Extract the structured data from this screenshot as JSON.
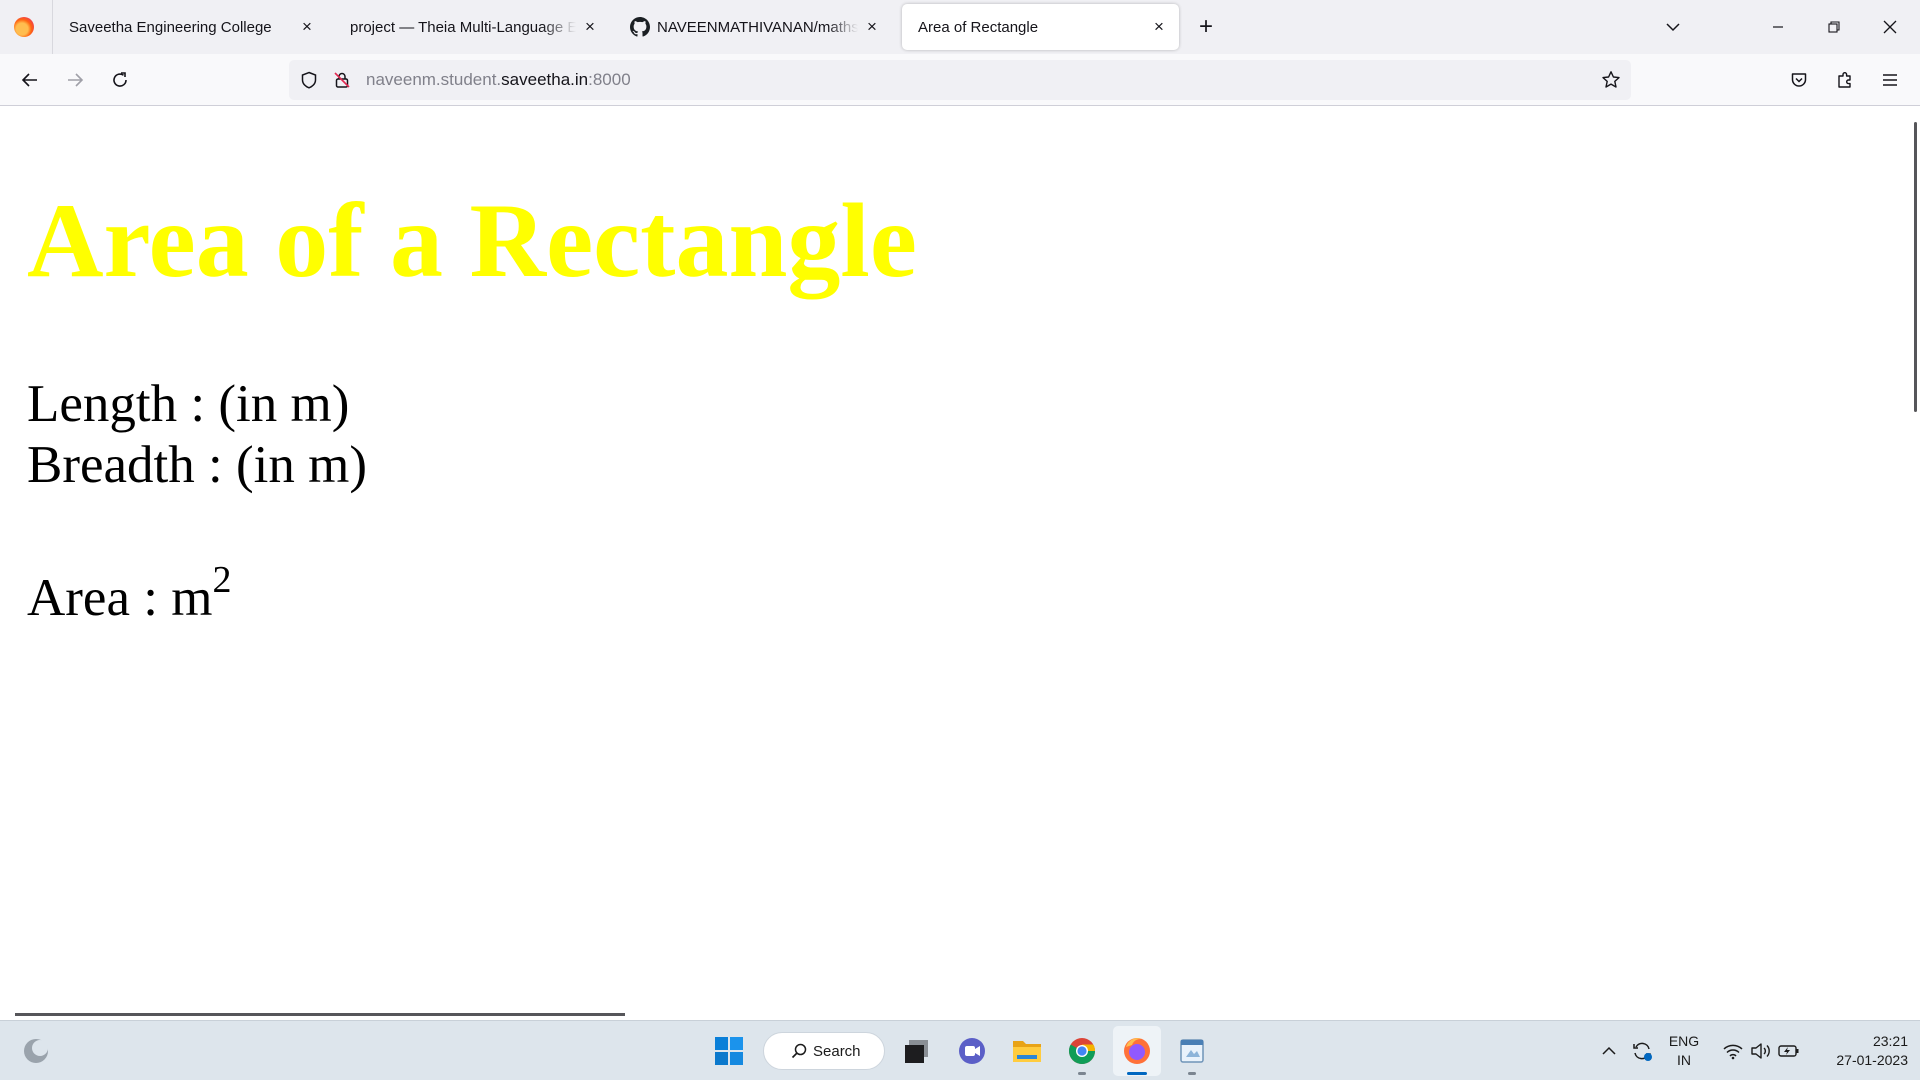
{
  "browser": {
    "tabs": [
      {
        "title": "Saveetha Engineering College",
        "active": false
      },
      {
        "title": "project — Theia Multi-Language Explorer",
        "active": false
      },
      {
        "title": "NAVEENMATHIVANAN/mathseries",
        "active": false
      },
      {
        "title": "Area of Rectangle",
        "active": true
      }
    ],
    "close_glyph": "×",
    "new_tab_glyph": "+",
    "url": {
      "prefix": "naveenm.student.",
      "domain": "saveetha.in",
      "port": ":8000"
    }
  },
  "page": {
    "heading": "Area of a Rectangle",
    "length_label": "Length : (in m)",
    "breadth_label": "Breadth : (in m)",
    "area_label": "Area : m",
    "area_sup": "2",
    "heading_color": "#ffff00"
  },
  "taskbar": {
    "search_label": "Search",
    "lang_top": "ENG",
    "lang_bottom": "IN",
    "time": "23:21",
    "date": "27-01-2023"
  }
}
